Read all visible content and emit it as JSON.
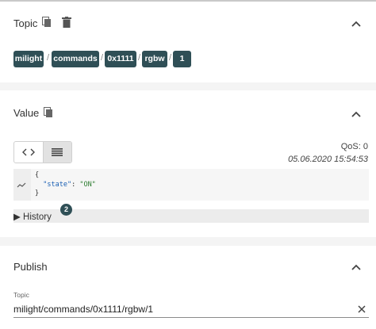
{
  "topic_panel": {
    "title": "Topic",
    "chips": [
      "milight",
      "commands",
      "0x1111",
      "rgbw",
      "1"
    ],
    "separator": "/"
  },
  "value_panel": {
    "title": "Value",
    "qos": "QoS: 0",
    "timestamp": "05.06.2020 15:54:53",
    "code_lines": {
      "open": "{",
      "key": "\"state\"",
      "colon": ": ",
      "value": "\"ON\"",
      "close": "}"
    },
    "history_label": "History",
    "history_count": "2"
  },
  "publish_panel": {
    "title": "Publish",
    "topic_label": "Topic",
    "topic_value": "milight/commands/0x1111/rgbw/1"
  },
  "icons": {
    "copy": "copy-icon",
    "delete": "trash-icon",
    "collapse": "chevron-up-icon",
    "raw_view": "code-icon",
    "formatted_view": "list-lines-icon",
    "chart": "trend-icon",
    "expand": "triangle-right-icon",
    "clear": "close-icon"
  },
  "colors": {
    "chip_bg": "#2f4f56",
    "chip_text": "#ffffff",
    "json_key": "#1a5fb4",
    "json_string": "#2e7d32"
  }
}
